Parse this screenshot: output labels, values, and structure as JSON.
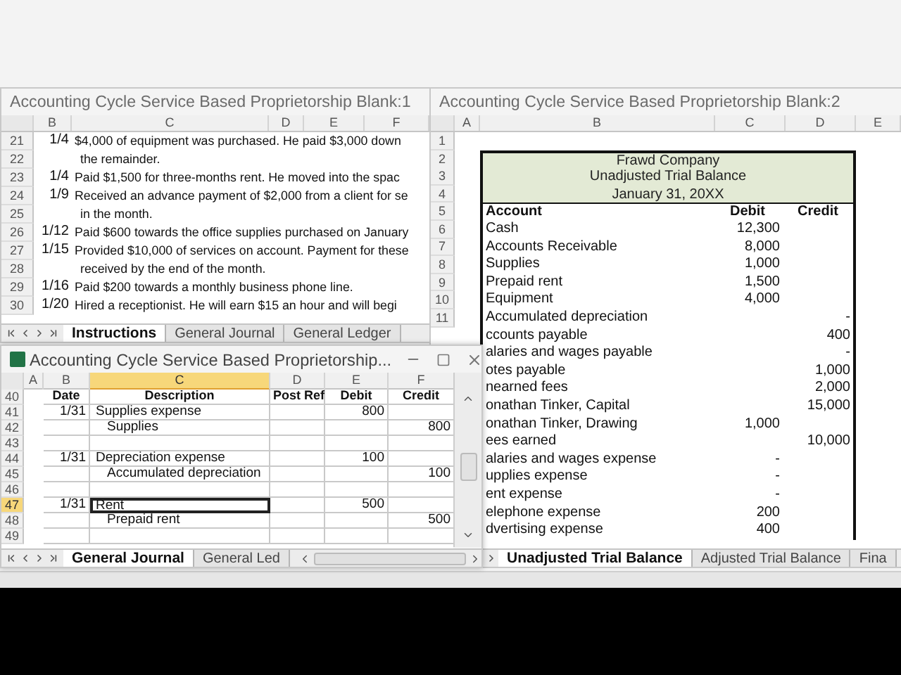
{
  "instructions_window": {
    "title": "Accounting Cycle Service Based Proprietorship Blank:1",
    "columns": [
      "B",
      "C",
      "D",
      "E",
      "F"
    ],
    "rows": [
      {
        "number": "21",
        "date": "1/4",
        "text": "$4,000 of equipment was purchased. He paid $3,000 down"
      },
      {
        "number": "22",
        "text": "the remainder."
      },
      {
        "number": "23",
        "date": "1/4",
        "text": "Paid $1,500 for three-months rent. He moved into the spac"
      },
      {
        "number": "24",
        "date": "1/9",
        "text": "Received an advance payment of $2,000 from a client for se"
      },
      {
        "number": "25",
        "text": "in the month."
      },
      {
        "number": "26",
        "date": "1/12",
        "text": "Paid $600 towards the office supplies purchased on January"
      },
      {
        "number": "27",
        "date": "1/15",
        "text": "Provided $10,000 of services on account. Payment for these"
      },
      {
        "number": "28",
        "text": "received by the end of the month."
      },
      {
        "number": "29",
        "date": "1/16",
        "text": "Paid $200 towards a monthly business phone line."
      },
      {
        "number": "30",
        "date": "1/20",
        "text": "Hired a receptionist. He will earn $15 an hour and will begi"
      }
    ],
    "tabs": [
      {
        "label": "Instructions",
        "selected": true
      },
      {
        "label": "General Journal",
        "selected": false
      },
      {
        "label": "General Ledger",
        "selected": false
      }
    ]
  },
  "trial_balance_window": {
    "title": "Accounting Cycle Service Based Proprietorship Blank:2",
    "columns": [
      "A",
      "B",
      "C",
      "D",
      "E"
    ],
    "row_numbers": [
      "1",
      "2",
      "3",
      "4",
      "5",
      "6",
      "7",
      "8",
      "9",
      "10",
      "11"
    ],
    "heading": [
      "Frawd Company",
      "Unadjusted Trial Balance",
      "January 31, 20XX"
    ],
    "header": {
      "account": "Account",
      "debit": "Debit",
      "credit": "Credit"
    },
    "rows": [
      {
        "account": "Cash",
        "debit": "12,300"
      },
      {
        "account": "Accounts Receivable",
        "debit": "8,000"
      },
      {
        "account": "Supplies",
        "debit": "1,000"
      },
      {
        "account": "Prepaid rent",
        "debit": "1,500"
      },
      {
        "account": "Equipment",
        "debit": "4,000"
      },
      {
        "account": "Accumulated depreciation",
        "credit": "-"
      },
      {
        "account": "ccounts payable",
        "credit": "400"
      },
      {
        "account": "alaries and wages payable",
        "credit": "-"
      },
      {
        "account": "otes payable",
        "credit": "1,000"
      },
      {
        "account": "nearned fees",
        "credit": "2,000"
      },
      {
        "account": "onathan Tinker, Capital",
        "credit": "15,000"
      },
      {
        "account": "onathan Tinker, Drawing",
        "debit": "1,000"
      },
      {
        "account": "ees earned",
        "credit": "10,000"
      },
      {
        "account": "alaries and wages expense",
        "debit": "-"
      },
      {
        "account": "upplies expense",
        "debit": "-"
      },
      {
        "account": "ent expense",
        "debit": "-"
      },
      {
        "account": "elephone expense",
        "debit": "200"
      },
      {
        "account": "dvertising expense",
        "debit": "400"
      }
    ],
    "tabs": [
      {
        "label": "Unadjusted Trial Balance",
        "selected": true
      },
      {
        "label": "Adjusted Trial Balance",
        "selected": false
      },
      {
        "label": "Fina",
        "selected": false
      }
    ]
  },
  "journal_window": {
    "title": "Accounting Cycle Service Based Proprietorship...",
    "columns": [
      {
        "label": "A",
        "selected": false
      },
      {
        "label": "B",
        "selected": false
      },
      {
        "label": "C",
        "selected": true
      },
      {
        "label": "D",
        "selected": false
      },
      {
        "label": "E",
        "selected": false
      },
      {
        "label": "F",
        "selected": false
      }
    ],
    "header_row": {
      "number": "40",
      "cells": [
        "Date",
        "Description",
        "Post Ref",
        "Debit",
        "Credit"
      ]
    },
    "rows": [
      {
        "number": "41",
        "selected": false,
        "indented": false,
        "date": "1/31",
        "description": "Supplies expense",
        "debit": "800"
      },
      {
        "number": "42",
        "selected": false,
        "indented": true,
        "description": "Supplies",
        "credit": "800"
      },
      {
        "number": "43",
        "selected": false
      },
      {
        "number": "44",
        "selected": false,
        "indented": false,
        "date": "1/31",
        "description": "Depreciation expense",
        "debit": "100"
      },
      {
        "number": "45",
        "selected": false,
        "indented": true,
        "description": "Accumulated depreciation",
        "credit": "100"
      },
      {
        "number": "46",
        "selected": false
      },
      {
        "number": "47",
        "selected": true,
        "indented": false,
        "date": "1/31",
        "description": "Rent",
        "debit": "500"
      },
      {
        "number": "48",
        "selected": false,
        "indented": true,
        "description": "Prepaid rent",
        "credit": "500"
      },
      {
        "number": "49",
        "selected": false
      }
    ],
    "tabs": [
      {
        "label": "General Journal",
        "selected": true
      },
      {
        "label": "General Led",
        "selected": false
      }
    ]
  }
}
